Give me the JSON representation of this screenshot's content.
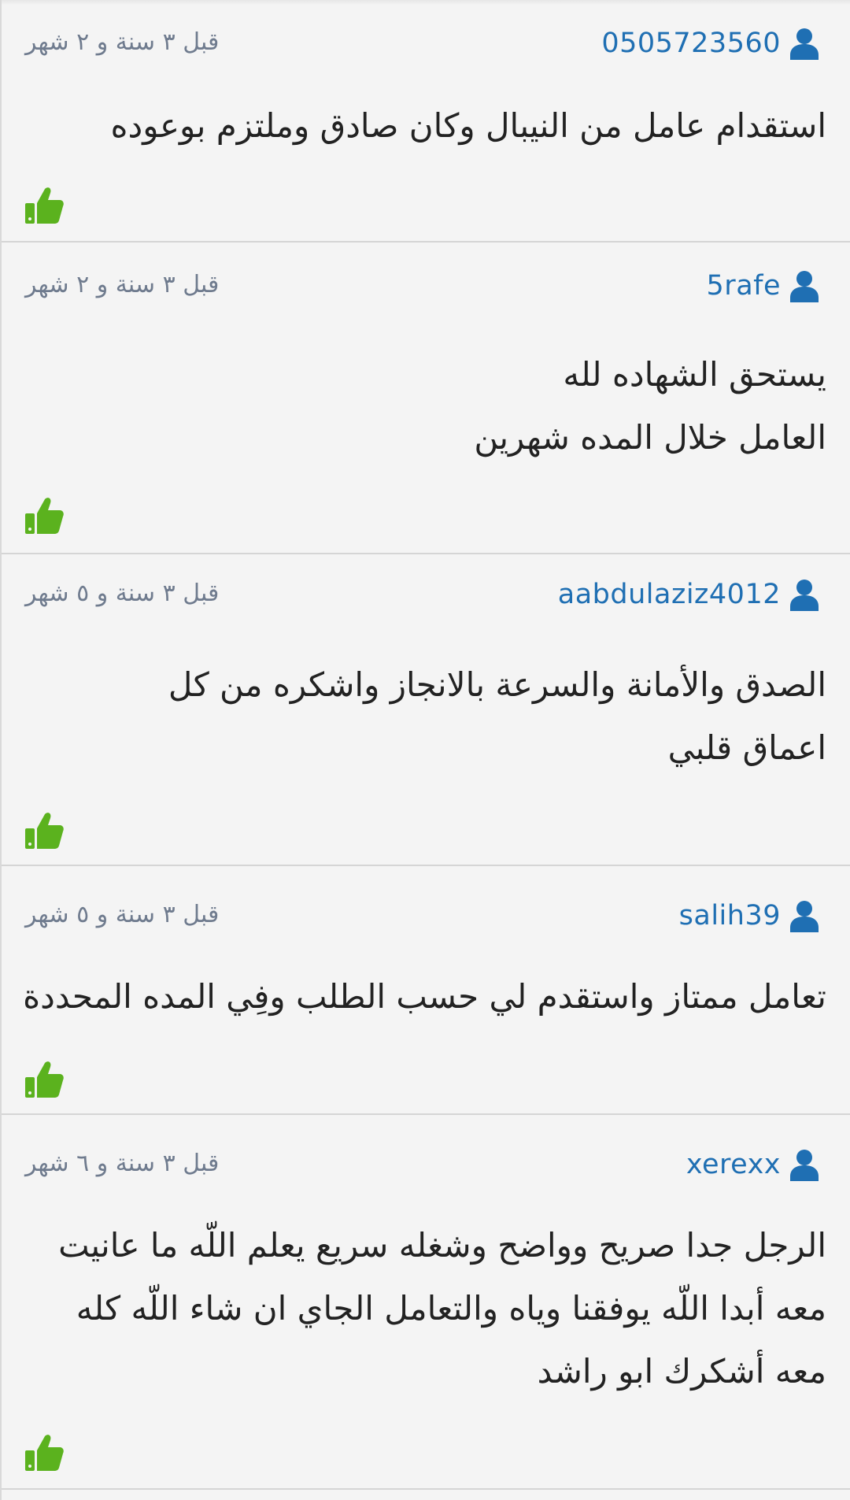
{
  "colors": {
    "author": "#1f6fb3",
    "timestamp": "#6f7b8e",
    "like": "#5bb21e",
    "background": "#f4f4f4",
    "divider": "#d5d5d5"
  },
  "icons": {
    "author": "user-icon",
    "like": "thumbs-up-icon"
  },
  "comments": [
    {
      "author": "0505723560",
      "time": "قبل ٣ سنة و ٢ شهر",
      "text": "استقدام عامل من النيبال وكان صادق وملتزم بوعوده"
    },
    {
      "author": "5rafe",
      "time": "قبل ٣ سنة و ٢ شهر",
      "text": "يستحق الشهاده لله\nالعامل خلال المده شهرين"
    },
    {
      "author": "aabdulaziz4012",
      "time": "قبل ٣ سنة و ٥ شهر",
      "text": "الصدق والأمانة والسرعة بالانجاز واشكره من كل اعماق قلبي"
    },
    {
      "author": "salih39",
      "time": "قبل ٣ سنة و ٥ شهر",
      "text": "تعامل ممتاز واستقدم لي حسب الطلب وفِي المده المحددة"
    },
    {
      "author": "xerexx",
      "time": "قبل ٣ سنة و ٦ شهر",
      "text": "الرجل جدا صريح وواضح وشغله سريع يعلم اللّه ما عانيت معه أبدا اللّه يوفقنا وياه والتعامل الجاي ان شاء اللّه كله معه أشكرك ابو راشد"
    }
  ]
}
